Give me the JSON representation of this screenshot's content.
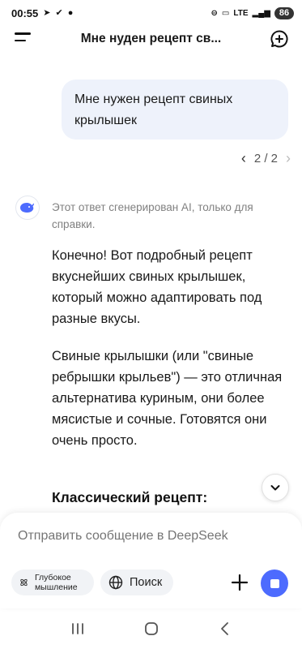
{
  "status": {
    "time": "00:55",
    "network": "LTE",
    "battery": "86"
  },
  "header": {
    "title": "Мне нуден рецепт св..."
  },
  "conversation": {
    "user_message": "Мне нужен рецепт свиных крылышек",
    "pager": "2 / 2",
    "ai_note": "Этот ответ сгенерирован AI, только для справки.",
    "ai_paragraph_1": "Конечно! Вот подробный рецепт вкуснейших свиных крылышек, который можно адаптировать под разные вкусы.",
    "ai_paragraph_2": "Свиные крылышки (или \"свиные ребрышки крыльев\") — это отличная альтернатива куриным, они более мясистые и сочные. Готовятся они очень просто.",
    "ai_heading": "Классический рецепт:"
  },
  "composer": {
    "placeholder": "Отправить сообщение в DeepSeek",
    "deep_think_label": "Глубокое мышление",
    "search_label": "Поиск"
  },
  "colors": {
    "accent": "#4d6bfe",
    "user_bubble": "#eef2fb"
  },
  "icons": [
    "menu-icon",
    "new-chat-icon",
    "deepseek-whale-icon",
    "chevron-down-icon",
    "atom-icon",
    "globe-icon",
    "plus-icon",
    "stop-icon"
  ]
}
